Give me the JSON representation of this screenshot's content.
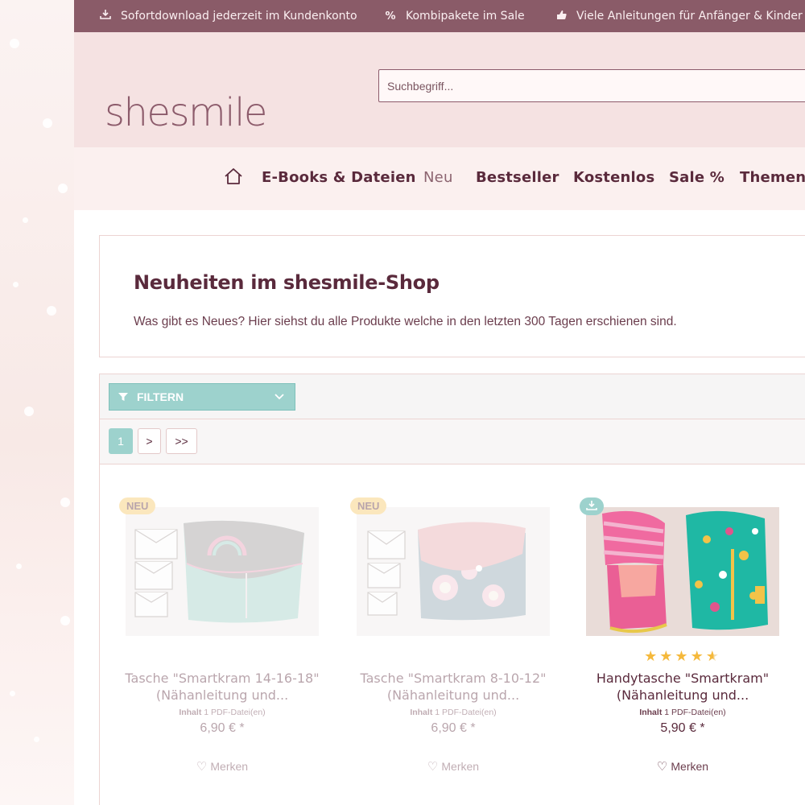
{
  "topbar": {
    "items": [
      {
        "icon": "download-icon",
        "label": "Sofortdownload jederzeit im Kundenkonto"
      },
      {
        "icon": "percent-icon",
        "label": "Kombipakete im Sale"
      },
      {
        "icon": "thumbs-up-icon",
        "label": "Viele Anleitungen für Anfänger & Kinder"
      }
    ]
  },
  "header": {
    "logo": "shesmile",
    "search_placeholder": "Suchbegriff..."
  },
  "nav": {
    "home_icon": "home-icon",
    "items": [
      {
        "label": "E-Books & Dateien"
      },
      {
        "label": "Neu",
        "active": true
      },
      {
        "label": "Bestseller"
      },
      {
        "label": "Kostenlos"
      },
      {
        "label": "Sale %"
      },
      {
        "label": "Themenw"
      }
    ]
  },
  "intro": {
    "title": "Neuheiten im shesmile-Shop",
    "text": "Was gibt es Neues? Hier siehst du alle Produkte welche in den letzten 300 Tagen erschienen sind."
  },
  "filter": {
    "label": "FILTERN"
  },
  "pagination": {
    "current": "1",
    "next": ">",
    "last": ">>"
  },
  "products": [
    {
      "badge": "NEU",
      "title_line1": "Tasche \"Smartkram 14-16-18\"",
      "title_line2": "(Nähanleitung und...",
      "content_label": "Inhalt",
      "content_value": "1 PDF-Datei(en)",
      "price": "6,90 € *",
      "wishlist": "Merken",
      "faded": true,
      "rating": 0
    },
    {
      "badge": "NEU",
      "title_line1": "Tasche \"Smartkram 8-10-12\"",
      "title_line2": "(Nähanleitung und...",
      "content_label": "Inhalt",
      "content_value": "1 PDF-Datei(en)",
      "price": "6,90 € *",
      "wishlist": "Merken",
      "faded": true,
      "rating": 0
    },
    {
      "badge": "",
      "title_line1": "Handytasche \"Smartkram\"",
      "title_line2": "(Nähanleitung und...",
      "content_label": "Inhalt",
      "content_value": "1 PDF-Datei(en)",
      "price": "5,90 € *",
      "wishlist": "Merken",
      "faded": false,
      "rating": 4.5
    }
  ],
  "colors": {
    "topbar": "#8a5b68",
    "header": "#f5e2e2",
    "accent_teal": "#9dd2cd",
    "badge_yellow": "#f7c763",
    "text_dark": "#5a2a3c"
  }
}
